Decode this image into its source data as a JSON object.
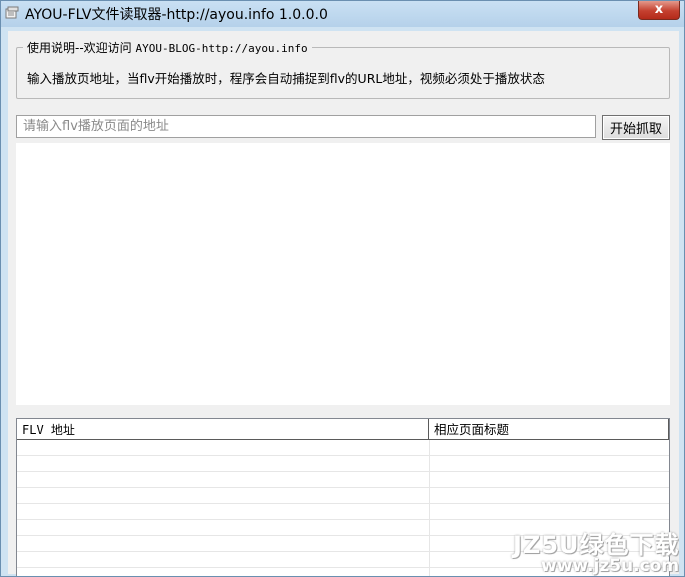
{
  "window": {
    "title": "AYOU-FLV文件读取器-http://ayou.info 1.0.0.0",
    "close_label": "x",
    "app_icon": "app-icon"
  },
  "instructions": {
    "legend_prefix": "使用说明--欢迎访问 ",
    "legend_link": "AYOU-BLOG-http://ayou.info",
    "description": "输入播放页地址，当flv开始播放时，程序会自动捕捉到flv的URL地址，视频必须处于播放状态"
  },
  "url_input": {
    "value": "",
    "placeholder": "请输入flv播放页面的地址"
  },
  "start_button": {
    "label": "开始抓取"
  },
  "results": {
    "columns": [
      {
        "label": "FLV 地址"
      },
      {
        "label": "相应页面标题"
      }
    ],
    "rows": []
  },
  "watermark": {
    "line1": "JZ5U绿色下载",
    "line2": "www.jz5u.com"
  }
}
